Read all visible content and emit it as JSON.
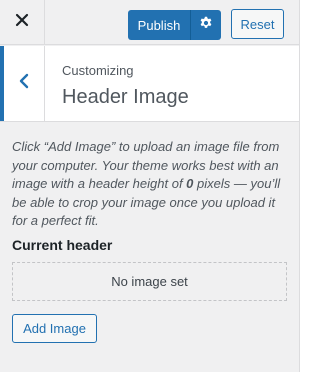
{
  "header": {
    "publish_label": "Publish",
    "reset_label": "Reset"
  },
  "section": {
    "breadcrumb": "Customizing",
    "title": "Header Image"
  },
  "description": {
    "before": "Click “Add Image” to upload an image file from your computer. Your theme works best with an image with a header height of ",
    "height_value": "0",
    "after": " pixels — you’ll be able to crop your image once you upload it for a perfect fit."
  },
  "current_header": {
    "label": "Current header",
    "placeholder": "No image set"
  },
  "actions": {
    "add_image_label": "Add Image"
  },
  "colors": {
    "accent": "#2271b1",
    "panel_bg": "#f0f0f1"
  }
}
